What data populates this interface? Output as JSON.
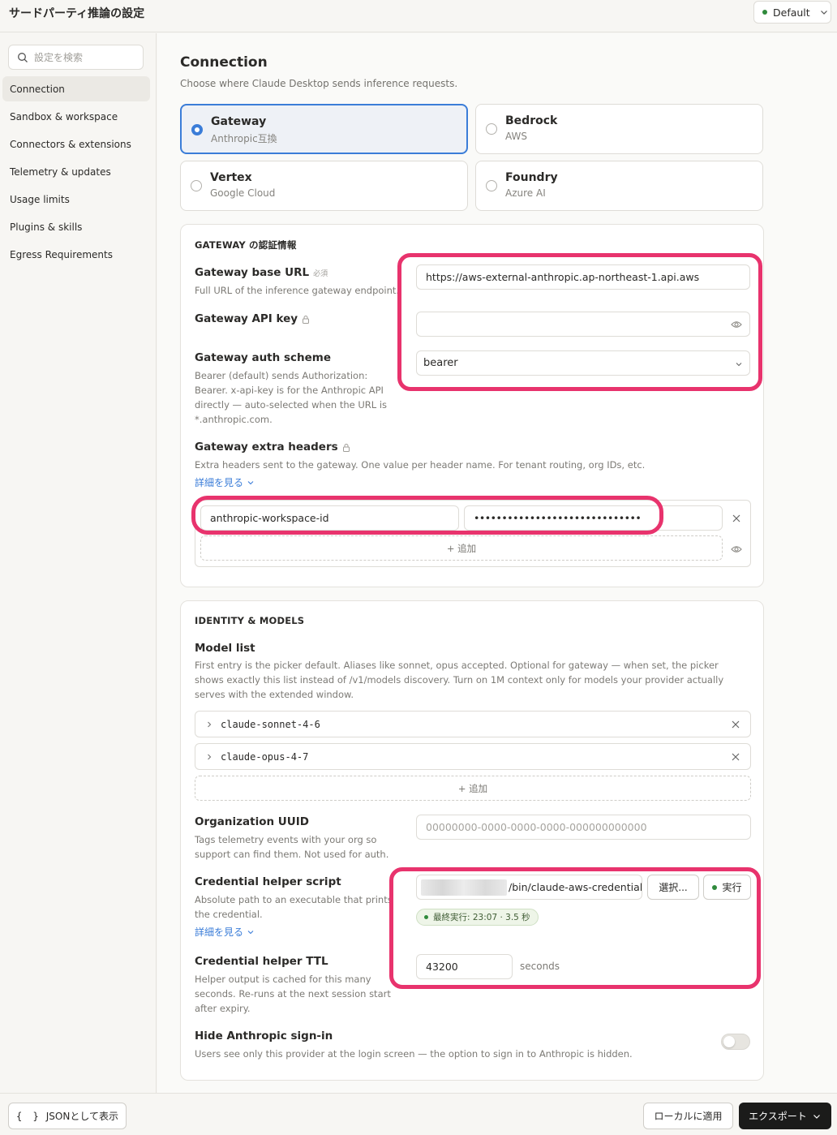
{
  "app": {
    "title": "サードパーティ推論の設定",
    "profile": "Default"
  },
  "sidebar": {
    "search_placeholder": "設定を検索",
    "items": [
      {
        "label": "Connection"
      },
      {
        "label": "Sandbox & workspace"
      },
      {
        "label": "Connectors & extensions"
      },
      {
        "label": "Telemetry & updates"
      },
      {
        "label": "Usage limits"
      },
      {
        "label": "Plugins & skills"
      },
      {
        "label": "Egress Requirements"
      }
    ]
  },
  "main": {
    "title": "Connection",
    "subtitle": "Choose where Claude Desktop sends inference requests.",
    "providers": [
      {
        "name": "Gateway",
        "sub": "Anthropic互換",
        "selected": true
      },
      {
        "name": "Bedrock",
        "sub": "AWS",
        "selected": false
      },
      {
        "name": "Vertex",
        "sub": "Google Cloud",
        "selected": false
      },
      {
        "name": "Foundry",
        "sub": "Azure AI",
        "selected": false
      }
    ]
  },
  "gateway": {
    "section_title": "GATEWAY の認証情報",
    "base_url": {
      "label": "Gateway base URL",
      "required": "必須",
      "hint": "Full URL of the inference gateway endpoint.",
      "value": "https://aws-external-anthropic.ap-northeast-1.api.aws"
    },
    "api_key": {
      "label": "Gateway API key",
      "value": ""
    },
    "auth_scheme": {
      "label": "Gateway auth scheme",
      "hint": "Bearer (default) sends Authorization: Bearer. x-api-key is for the Anthropic API directly — auto-selected when the URL is *.anthropic.com.",
      "value": "bearer"
    },
    "extra_headers": {
      "label": "Gateway extra headers",
      "hint": "Extra headers sent to the gateway. One value per header name. For tenant routing, org IDs, etc.",
      "details_link": "詳細を見る",
      "header_name": "anthropic-workspace-id",
      "header_value": "••••••••••••••••••••••••••••••",
      "add_label": "+ 追加"
    }
  },
  "identity": {
    "section_title": "IDENTITY & MODELS",
    "model_list": {
      "label": "Model list",
      "hint": "First entry is the picker default. Aliases like sonnet, opus accepted. Optional for gateway — when set, the picker shows exactly this list instead of /v1/models discovery. Turn on 1M context only for models your provider actually serves with the extended window.",
      "models": [
        "claude-sonnet-4-6",
        "claude-opus-4-7"
      ],
      "add_label": "+ 追加"
    },
    "org_uuid": {
      "label": "Organization UUID",
      "hint": "Tags telemetry events with your org so support can find them. Not used for auth.",
      "placeholder": "00000000-0000-0000-0000-000000000000"
    },
    "credential_helper": {
      "label": "Credential helper script",
      "hint": "Absolute path to an executable that prints the credential.",
      "details_link": "詳細を見る",
      "path_suffix": "/bin/claude-aws-credential-",
      "choose_label": "選択...",
      "run_label": "実行",
      "last_run": "最終実行: 23:07 · 3.5 秒"
    },
    "ttl": {
      "label": "Credential helper TTL",
      "hint": "Helper output is cached for this many seconds. Re-runs at the next session start after expiry.",
      "value": "43200",
      "unit": "seconds"
    },
    "hide_signin": {
      "label": "Hide Anthropic sign-in",
      "hint": "Users see only this provider at the login screen — the option to sign in to Anthropic is hidden.",
      "enabled": false
    }
  },
  "footer": {
    "json_label": "JSONとして表示",
    "json_icon": "{ }",
    "apply_label": "ローカルに適用",
    "export_label": "エクスポート"
  },
  "colors": {
    "accent": "#3b7dd8",
    "highlight": "#e8336d",
    "status_green": "#2f8a3c"
  }
}
